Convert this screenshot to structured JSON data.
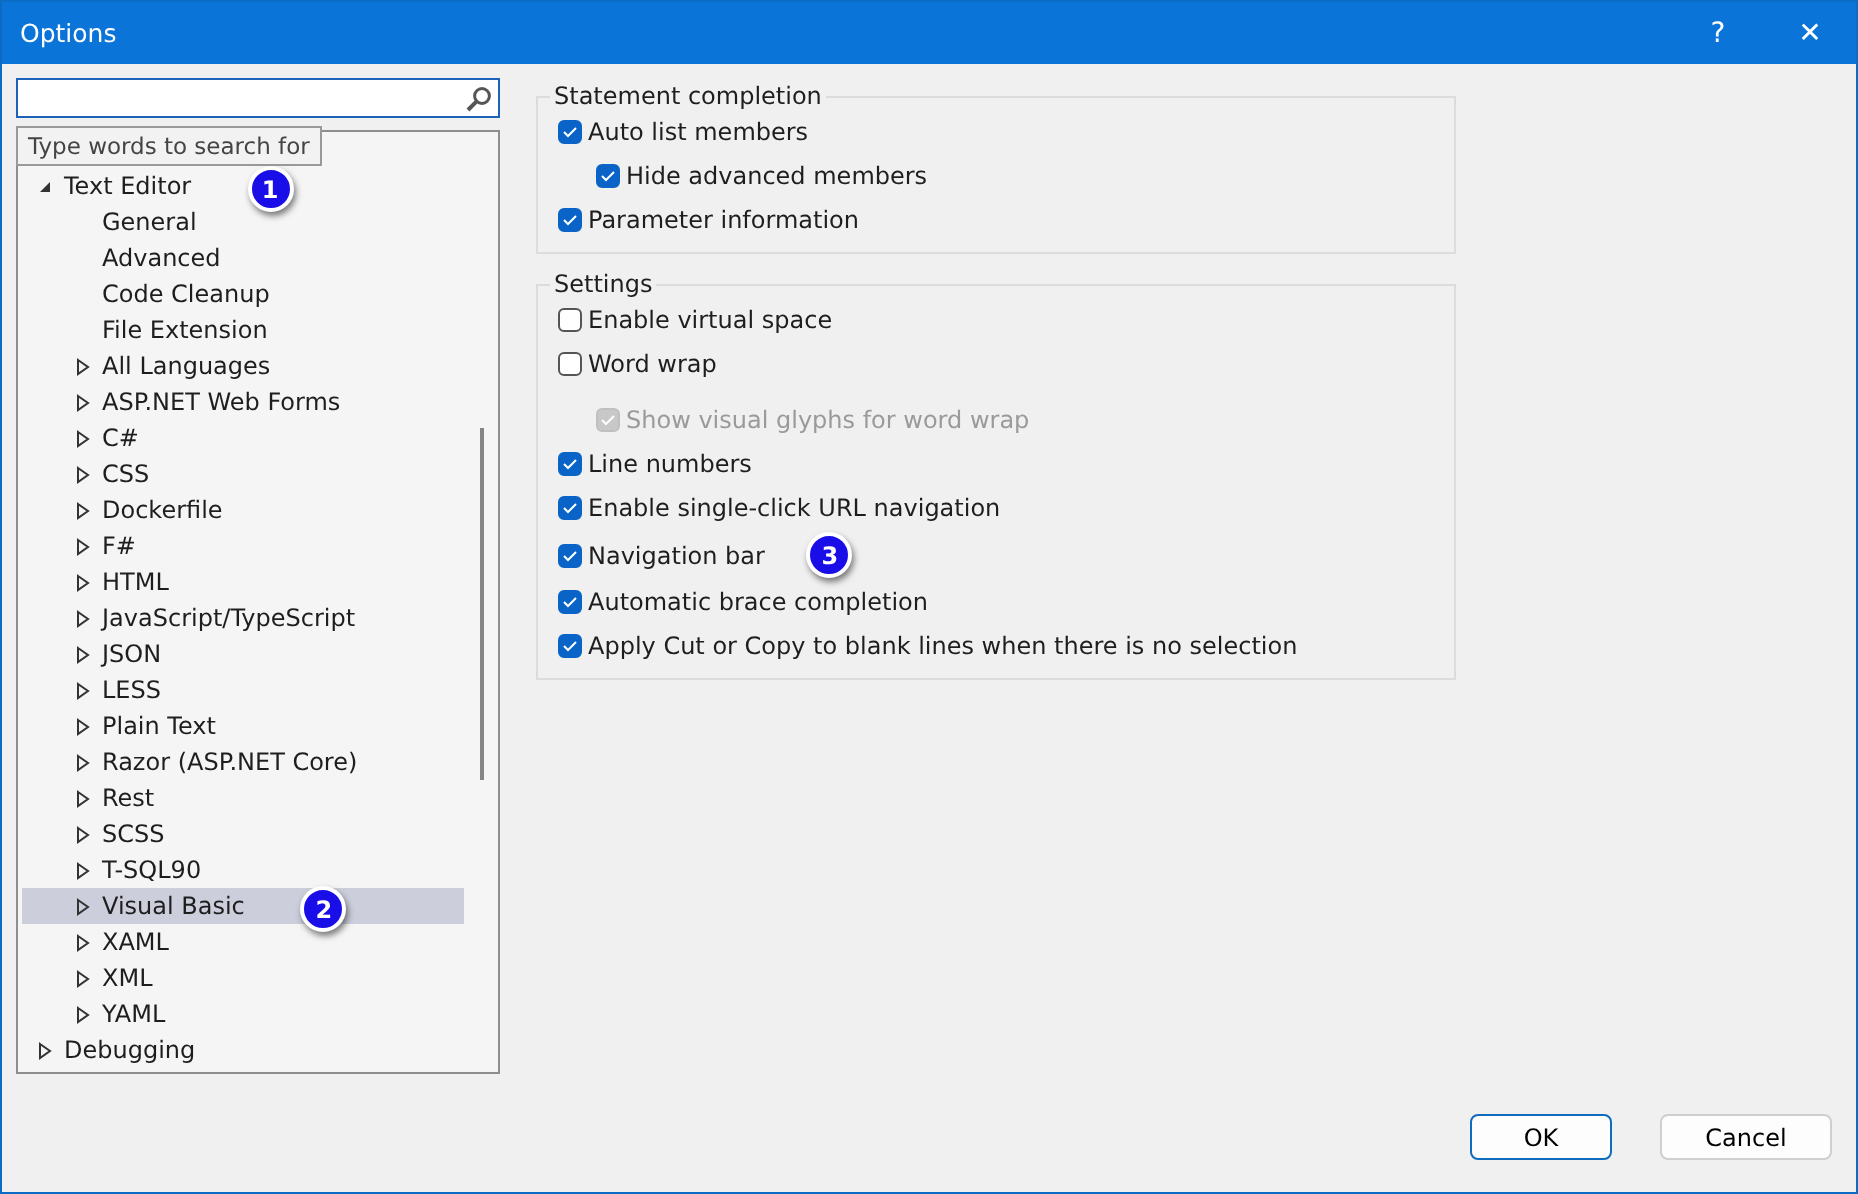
{
  "window": {
    "title": "Options",
    "buttons": [
      "?",
      "✕"
    ]
  },
  "search": {
    "tooltip": "Type words to search for"
  },
  "tree": [
    {
      "label": "Text Editor",
      "expanded": true,
      "selected": false,
      "children": [
        {
          "label": "General",
          "selected": false
        },
        {
          "label": "Advanced",
          "selected": false
        },
        {
          "label": "Code Cleanup",
          "selected": false
        },
        {
          "label": "File Extension",
          "selected": false
        },
        {
          "label": "All Languages",
          "expanded": false,
          "selected": false
        },
        {
          "label": "ASP.NET Web Forms",
          "expanded": false,
          "selected": false
        },
        {
          "label": "C#",
          "expanded": false,
          "selected": false
        },
        {
          "label": "CSS",
          "expanded": false,
          "selected": false
        },
        {
          "label": "Dockerfile",
          "expanded": false,
          "selected": false
        },
        {
          "label": "F#",
          "expanded": false,
          "selected": false
        },
        {
          "label": "HTML",
          "expanded": false,
          "selected": false
        },
        {
          "label": "JavaScript/TypeScript",
          "expanded": false,
          "selected": false
        },
        {
          "label": "JSON",
          "expanded": false,
          "selected": false
        },
        {
          "label": "LESS",
          "expanded": false,
          "selected": false
        },
        {
          "label": "Plain Text",
          "expanded": false,
          "selected": false
        },
        {
          "label": "Razor (ASP.NET Core)",
          "expanded": false,
          "selected": false
        },
        {
          "label": "Rest",
          "expanded": false,
          "selected": false
        },
        {
          "label": "SCSS",
          "expanded": false,
          "selected": false
        },
        {
          "label": "T-SQL90",
          "expanded": false,
          "selected": false
        },
        {
          "label": "Visual Basic",
          "expanded": false,
          "selected": true,
          "callout": "2"
        },
        {
          "label": "XAML",
          "expanded": false,
          "selected": false
        },
        {
          "label": "XML",
          "expanded": false,
          "selected": false
        },
        {
          "label": "YAML",
          "expanded": false,
          "selected": false
        }
      ],
      "callout": "1"
    },
    {
      "label": "Debugging",
      "expanded": false,
      "selected": false
    }
  ],
  "groups": [
    {
      "title": "Statement completion",
      "options": [
        {
          "label": "Auto list members",
          "checked": true,
          "disabled": false,
          "children": [
            {
              "label": "Hide advanced members",
              "checked": true,
              "disabled": false
            }
          ]
        },
        {
          "label": "Parameter information",
          "checked": true,
          "disabled": false
        }
      ]
    },
    {
      "title": "Settings",
      "options": [
        {
          "label": "Enable virtual space",
          "checked": false,
          "disabled": false
        },
        {
          "label": "Word wrap",
          "checked": false,
          "disabled": false,
          "children": [
            {
              "label": "Show visual glyphs for word wrap",
              "checked": true,
              "disabled": true
            }
          ]
        },
        {
          "label": "Line numbers",
          "checked": true,
          "disabled": false
        },
        {
          "label": "Enable single-click URL navigation",
          "checked": true,
          "disabled": false
        },
        {
          "label": "Navigation bar",
          "checked": true,
          "disabled": false,
          "callout": "3"
        },
        {
          "label": "Automatic brace completion",
          "checked": true,
          "disabled": false
        },
        {
          "label": "Apply Cut or Copy to blank lines when there is no selection",
          "checked": true,
          "disabled": false
        }
      ]
    }
  ],
  "buttons": [
    {
      "label": "OK",
      "kind": "default"
    },
    {
      "label": "Cancel",
      "kind": "normal"
    }
  ]
}
